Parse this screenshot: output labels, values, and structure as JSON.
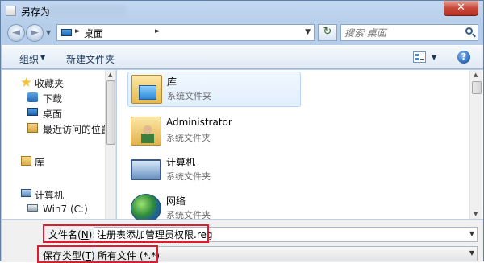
{
  "window": {
    "title": "另存为",
    "close_label": "✕"
  },
  "nav": {
    "back_icon": "◄",
    "forward_icon": "►",
    "address": "桌面",
    "address_arrow": "►",
    "refresh_icon": "↻",
    "search_placeholder": "搜索 桌面"
  },
  "toolbar": {
    "organize_label": "组织",
    "organize_arrow": "▼",
    "new_folder_label": "新建文件夹",
    "view_arrow": "▼",
    "help_label": "?"
  },
  "sidebar": {
    "items": [
      {
        "label": "收藏夹",
        "icon": "favorites-star-icon"
      },
      {
        "label": "下载",
        "icon": "downloads-icon"
      },
      {
        "label": "桌面",
        "icon": "desktop-icon"
      },
      {
        "label": "最近访问的位置",
        "icon": "recent-places-icon"
      },
      {
        "label": "库",
        "icon": "libraries-icon"
      },
      {
        "label": "计算机",
        "icon": "computer-icon"
      },
      {
        "label": "Win7 (C:)",
        "icon": "drive-icon"
      }
    ]
  },
  "files": [
    {
      "name": "库",
      "type": "系统文件夹",
      "icon": "library-folder-icon",
      "selected": true
    },
    {
      "name": "Administrator",
      "type": "系统文件夹",
      "icon": "user-folder-icon",
      "selected": false
    },
    {
      "name": "计算机",
      "type": "系统文件夹",
      "icon": "computer-icon",
      "selected": false
    },
    {
      "name": "网络",
      "type": "系统文件夹",
      "icon": "network-icon",
      "selected": false
    }
  ],
  "form": {
    "filename_label_prefix": "文件名(",
    "filename_label_key": "N",
    "filename_label_suffix": "):",
    "filename_value": "注册表添加管理员权限.reg",
    "savetype_label_prefix": "保存类型(",
    "savetype_label_key": "T",
    "savetype_label_suffix": "):",
    "savetype_value": "所有文件 (*.*)",
    "dropdown_arrow": "▼"
  },
  "colors": {
    "highlight_border": "#e01b2e",
    "selection_bg": "#e1effd"
  }
}
